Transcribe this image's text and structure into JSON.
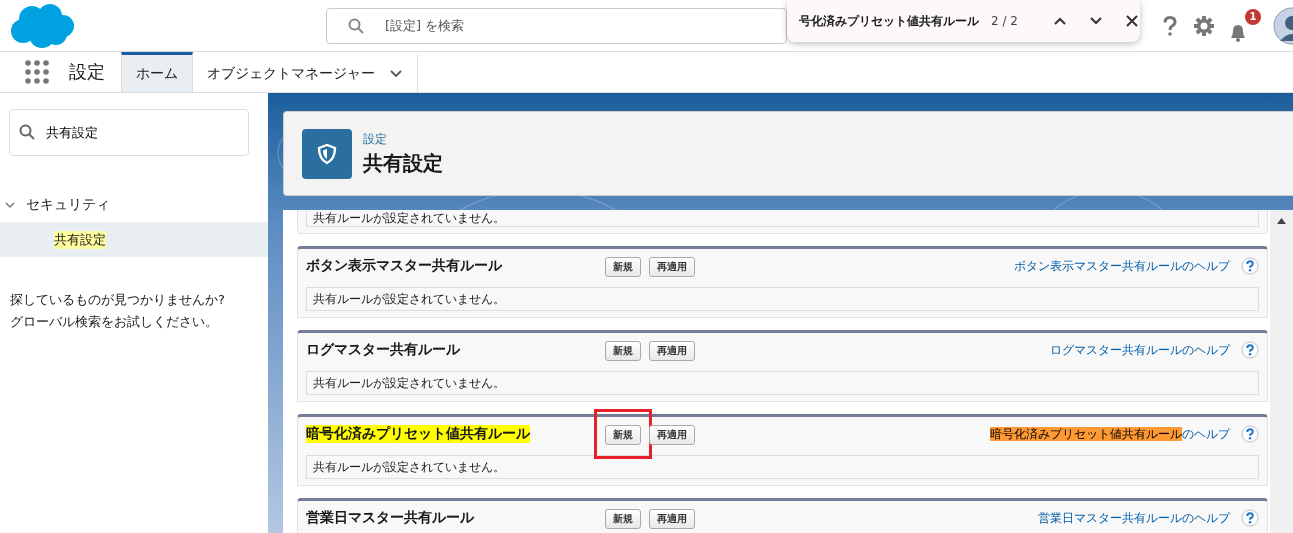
{
  "header": {
    "search": {
      "placeholder": "[設定] を検索"
    },
    "notifications": {
      "count": "1"
    }
  },
  "find_bar": {
    "query": "号化済みプリセット値共有ルール",
    "count": "2 / 2"
  },
  "app_nav": {
    "app_name": "設定",
    "tabs": [
      {
        "label": "ホーム",
        "selected": true,
        "has_menu": false
      },
      {
        "label": "オブジェクトマネージャー",
        "selected": false,
        "has_menu": true
      }
    ]
  },
  "sidebar": {
    "search": {
      "value": "共有設定"
    },
    "tree": [
      {
        "label": "セキュリティ",
        "expanded": true,
        "children": [
          {
            "label": "共有設定",
            "selected": true,
            "match": true
          }
        ]
      }
    ],
    "empty_hint": "探しているものが見つかりませんか?\nグローバル検索をお試しください。"
  },
  "page_header": {
    "breadcrumb": "設定",
    "title": "共有設定"
  },
  "sections": [
    {
      "kind": "cut",
      "message": "共有ルールが設定されていません。"
    },
    {
      "kind": "full",
      "title": "ボタン表示マスター共有ルール",
      "title_match": false,
      "buttons": [
        {
          "label": "新規",
          "annotated": false
        },
        {
          "label": "再適用",
          "annotated": false
        }
      ],
      "help_link": [
        {
          "text": "ボタン表示マスター共有ルールのヘルプ",
          "match": false
        }
      ],
      "message": "共有ルールが設定されていません。"
    },
    {
      "kind": "full",
      "title": "ログマスター共有ルール",
      "title_match": false,
      "buttons": [
        {
          "label": "新規",
          "annotated": false
        },
        {
          "label": "再適用",
          "annotated": false
        }
      ],
      "help_link": [
        {
          "text": "ログマスター共有ルールのヘルプ",
          "match": false
        }
      ],
      "message": "共有ルールが設定されていません。"
    },
    {
      "kind": "full",
      "title": "暗号化済みプリセット値共有ルール",
      "title_match": true,
      "buttons": [
        {
          "label": "新規",
          "annotated": true
        },
        {
          "label": "再適用",
          "annotated": false
        }
      ],
      "help_link": [
        {
          "text": "暗号化済みプリセット値共有ルール",
          "match": true
        },
        {
          "text": "のヘルプ",
          "match": false
        }
      ],
      "message": "共有ルールが設定されていません。"
    },
    {
      "kind": "full",
      "title": "営業日マスター共有ルール",
      "title_match": false,
      "buttons": [
        {
          "label": "新規",
          "annotated": false
        },
        {
          "label": "再適用",
          "annotated": false
        }
      ],
      "help_link": [
        {
          "text": "営業日マスター共有ルールのヘルプ",
          "match": false
        }
      ]
    }
  ]
}
